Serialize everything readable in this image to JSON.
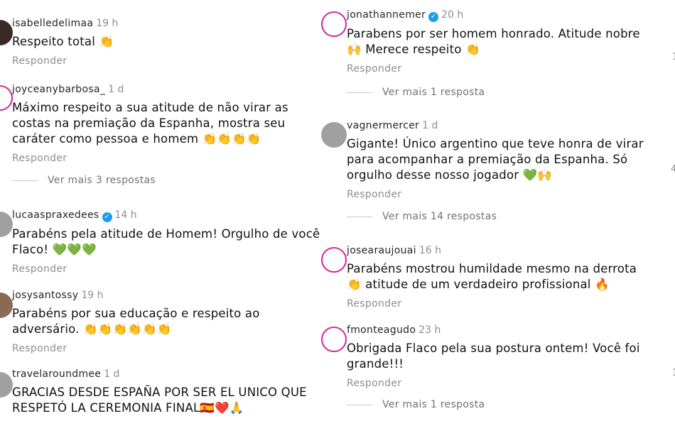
{
  "reply_label": "Responder",
  "left": [
    {
      "user": "isabelledelimaa",
      "time": "19 h",
      "verified": false,
      "text": "Respeito total 👏"
    },
    {
      "user": "joyceanybarbosa_",
      "time": "1 d",
      "verified": false,
      "text": "Máximo respeito a sua atitude de não virar as costas na premiação da Espanha, mostra seu caráter como pessoa e homem 👏👏👏👏",
      "more": "Ver mais 3 respostas"
    },
    {
      "user": "lucaaspraxedees",
      "time": "14 h",
      "verified": true,
      "text": "Parabéns pela atitude de Homem! Orgulho de você Flaco! 💚💚💚"
    },
    {
      "user": "josysantossy",
      "time": "19 h",
      "verified": false,
      "text": "Parabéns por sua educação e respeito ao adversário. 👏👏👏👏👏👏"
    },
    {
      "user": "travelaroundmee",
      "time": "1 d",
      "verified": false,
      "text": "GRACIAS DESDE ESPAÑA POR SER EL UNICO QUE RESPETÓ LA CEREMONIA FINAL🇪🇸❤️🙏"
    }
  ],
  "right": [
    {
      "user": "jonathannemer",
      "time": "20 h",
      "verified": true,
      "text": "Parabens por ser homem honrado. Atitude nobre 🙌 Merece respeito 👏",
      "more": "Ver mais 1 resposta"
    },
    {
      "user": "vagnermercer",
      "time": "1 d",
      "verified": false,
      "text": "Gigante! Único argentino que teve honra de virar para acompanhar a premiação da Espanha. Só orgulho desse nosso jogador 💚🙌",
      "more": "Ver mais 14 respostas"
    },
    {
      "user": "josearaujouai",
      "time": "16 h",
      "verified": false,
      "text": "Parabéns mostrou humildade mesmo na derrota 👏 atitude de um verdadeiro profissional 🔥"
    },
    {
      "user": "fmonteagudo",
      "time": "23 h",
      "verified": false,
      "text": "Obrigada Flaco pela sua postura ontem! Você foi grande!!!",
      "more": "Ver mais 1 resposta"
    }
  ],
  "edge_counts": [
    "1",
    "4",
    "1"
  ]
}
